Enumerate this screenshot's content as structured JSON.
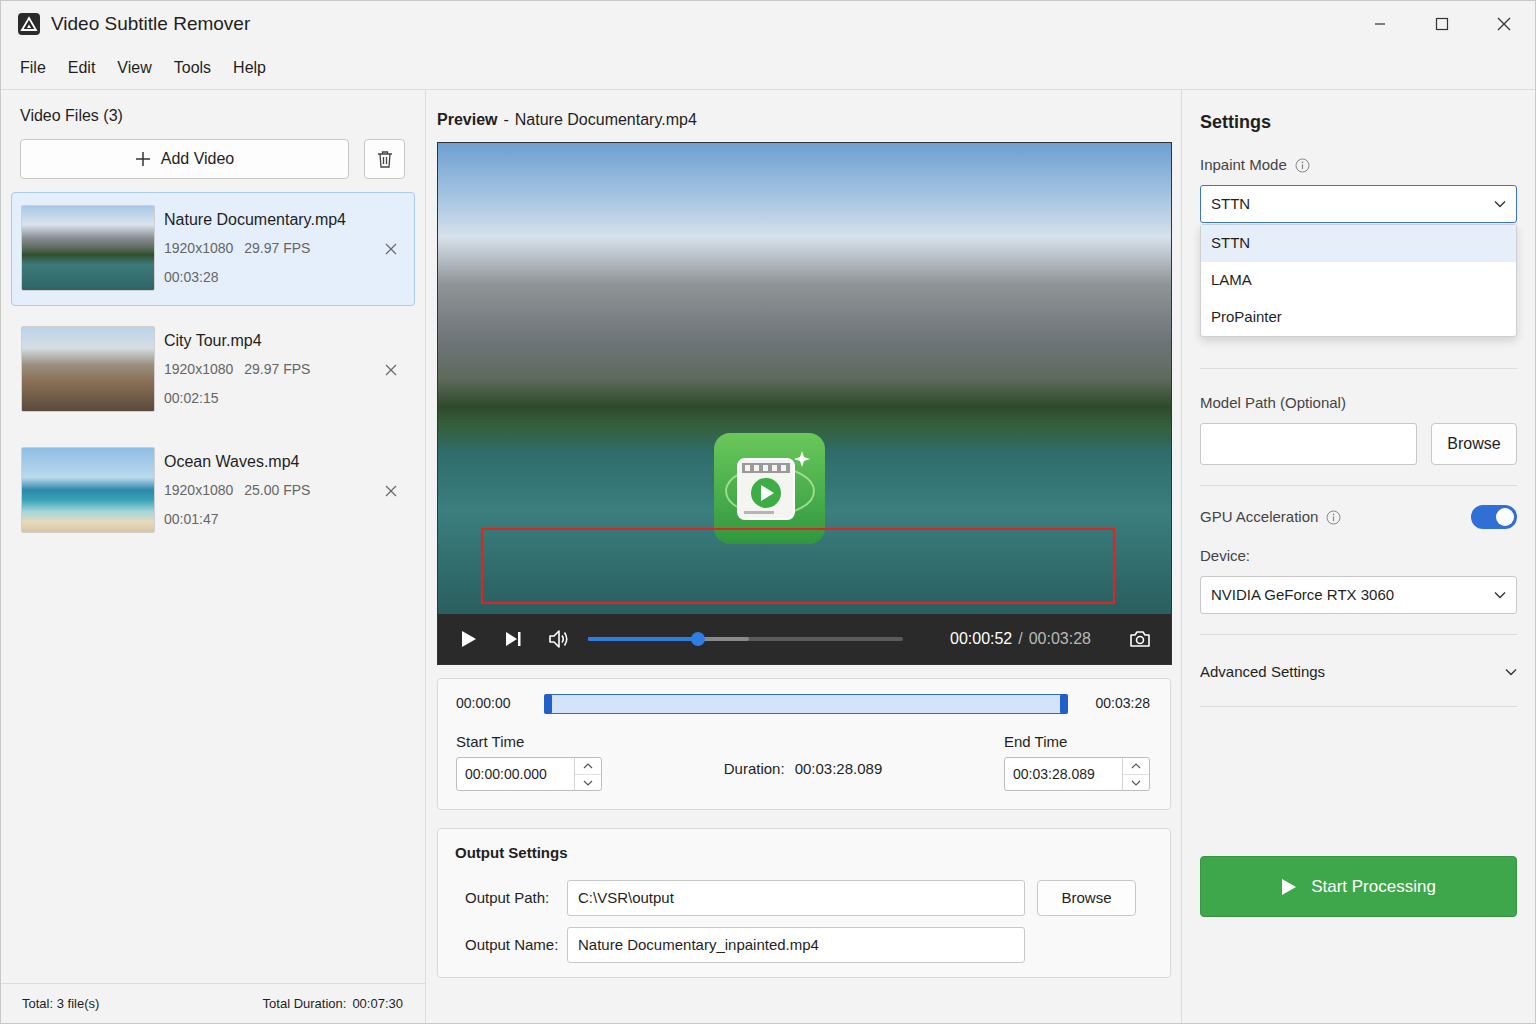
{
  "window": {
    "title": "Video Subtitle Remover"
  },
  "menu": [
    {
      "label": "File"
    },
    {
      "label": "Edit"
    },
    {
      "label": "View"
    },
    {
      "label": "Tools"
    },
    {
      "label": "Help"
    }
  ],
  "files": {
    "title": "Video Files (3)",
    "add_button": "Add Video",
    "items": [
      {
        "name": "Nature Documentary.mp4",
        "resolution": "1920x1080",
        "fps": "29.97 FPS",
        "duration": "00:03:28",
        "selected": true
      },
      {
        "name": "City Tour.mp4",
        "resolution": "1920x1080",
        "fps": "29.97 FPS",
        "duration": "00:02:15",
        "selected": false
      },
      {
        "name": "Ocean Waves.mp4",
        "resolution": "1920x1080",
        "fps": "25.00 FPS",
        "duration": "00:01:47",
        "selected": false
      }
    ],
    "total": "Total: 3 file(s)",
    "total_duration_label": "Total Duration:",
    "total_duration": "00:07:30"
  },
  "preview": {
    "label": "Preview",
    "separator": "-",
    "file": "Nature Documentary.mp4",
    "playing": false,
    "progress": 0.35,
    "buffered": 0.51,
    "current_time": "00:00:52",
    "time_separator": "/",
    "total_time": "00:03:28"
  },
  "trim": {
    "range_start_label": "00:00:00",
    "range_end_label": "00:03:28",
    "range_start": 0,
    "range_end": 1,
    "start_label": "Start Time",
    "start_value": "00:00:00.000",
    "duration_label": "Duration:",
    "duration": "00:03:28.089",
    "end_label": "End Time",
    "end_value": "00:03:28.089"
  },
  "output": {
    "title": "Output Settings",
    "path_label": "Output Path:",
    "path": "C:\\VSR\\output",
    "browse": "Browse",
    "name_label": "Output Name:",
    "name": "Nature Documentary_inpainted.mp4"
  },
  "settings": {
    "title": "Settings",
    "inpaint_label": "Inpaint Mode",
    "inpaint_value": "STTN",
    "inpaint_open": true,
    "options": [
      {
        "label": "STTN",
        "selected": true
      },
      {
        "label": "LAMA",
        "selected": false
      },
      {
        "label": "ProPainter",
        "selected": false
      }
    ],
    "model_label": "Model Path (Optional)",
    "model_value": "",
    "model_browse": "Browse",
    "gpu_label": "GPU Acceleration",
    "gpu_on": true,
    "device_label": "Device:",
    "device_value": "NVIDIA GeForce RTX 3060",
    "advanced_label": "Advanced Settings",
    "advanced_expanded": false,
    "start_button": "Start Processing"
  }
}
